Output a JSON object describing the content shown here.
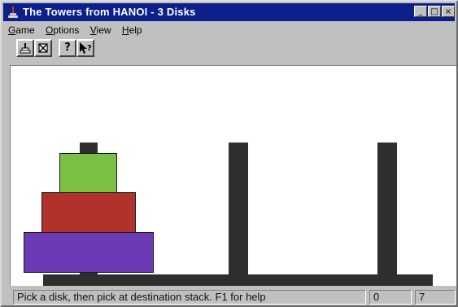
{
  "window": {
    "title": "The Towers from HANOI - 3 Disks",
    "title_bar_color": "#0c1f8a",
    "buttons": {
      "minimize_icon": "minimize-icon",
      "maximize_icon": "maximize-icon",
      "close_icon": "close-icon"
    }
  },
  "menu": {
    "items": [
      {
        "key": "G",
        "rest": "ame"
      },
      {
        "key": "O",
        "rest": "ptions"
      },
      {
        "key": "V",
        "rest": "iew"
      },
      {
        "key": "H",
        "rest": "elp"
      }
    ]
  },
  "toolbar": {
    "icons": [
      "new-game-icon",
      "stop-icon",
      "help-icon",
      "context-help-icon"
    ]
  },
  "game": {
    "pegs": 3,
    "disks": [
      {
        "size": 1,
        "peg": 1,
        "color": "#7ac143"
      },
      {
        "size": 2,
        "peg": 1,
        "color": "#b0322a"
      },
      {
        "size": 3,
        "peg": 1,
        "color": "#6a3bb5"
      }
    ],
    "peg_color": "#2f2f2f"
  },
  "status": {
    "message": "Pick a disk, then pick at destination stack. F1 for help",
    "moves": "0",
    "minimum_moves": "7"
  }
}
